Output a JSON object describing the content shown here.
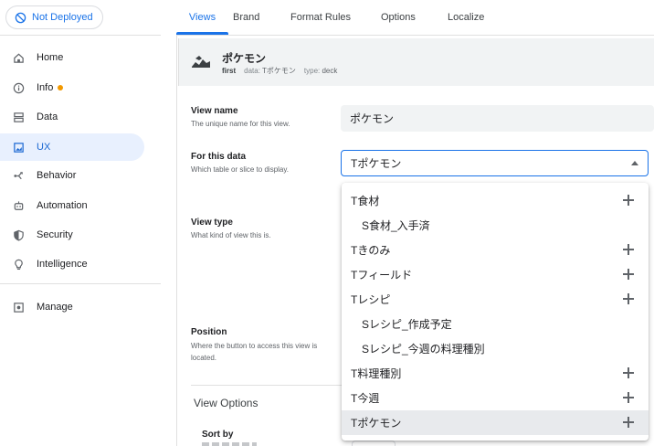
{
  "deploy": {
    "label": "Not Deployed"
  },
  "sidebar": {
    "items": [
      {
        "label": "Home",
        "icon": "home-icon"
      },
      {
        "label": "Info",
        "icon": "info-icon"
      },
      {
        "label": "Data",
        "icon": "data-icon"
      },
      {
        "label": "UX",
        "icon": "ux-icon"
      },
      {
        "label": "Behavior",
        "icon": "behavior-icon"
      },
      {
        "label": "Automation",
        "icon": "automation-icon"
      },
      {
        "label": "Security",
        "icon": "security-icon"
      },
      {
        "label": "Intelligence",
        "icon": "intelligence-icon"
      },
      {
        "label": "Manage",
        "icon": "manage-icon"
      }
    ],
    "active": "UX",
    "info_dot_color": "#f29900"
  },
  "tabs": [
    {
      "label": "Views"
    },
    {
      "label": "Brand"
    },
    {
      "label": "Format Rules"
    },
    {
      "label": "Options"
    },
    {
      "label": "Localize"
    }
  ],
  "view": {
    "title": "ポケモン",
    "position": "first",
    "data_key": "data:",
    "data_value": "Tポケモン",
    "type_key": "type:",
    "type_value": "deck"
  },
  "form": {
    "view_name": {
      "label": "View name",
      "help": "The unique name for this view.",
      "value": "ポケモン"
    },
    "for_data": {
      "label": "For this data",
      "help": "Which table or slice to display.",
      "value": "Tポケモン"
    },
    "view_type": {
      "label": "View type",
      "help": "What kind of view this is."
    },
    "position": {
      "label": "Position",
      "help": "Where the button to access this view is located."
    },
    "view_options": "View Options",
    "sort_by": "Sort by"
  },
  "dropdown": {
    "options": [
      {
        "label": "T食材",
        "sub": false,
        "add": true
      },
      {
        "label": "S食材_入手済",
        "sub": true,
        "add": false
      },
      {
        "label": "Tきのみ",
        "sub": false,
        "add": true
      },
      {
        "label": "Tフィールド",
        "sub": false,
        "add": true
      },
      {
        "label": "Tレシピ",
        "sub": false,
        "add": true
      },
      {
        "label": "Sレシピ_作成予定",
        "sub": true,
        "add": false
      },
      {
        "label": "Sレシピ_今週の料理種別",
        "sub": true,
        "add": false
      },
      {
        "label": "T料理種別",
        "sub": false,
        "add": true
      },
      {
        "label": "T今週",
        "sub": false,
        "add": true
      },
      {
        "label": "Tポケモン",
        "sub": false,
        "add": true,
        "selected": true
      }
    ]
  },
  "colors": {
    "accent": "#1a73e8",
    "active_bg": "#e8f0fe"
  }
}
